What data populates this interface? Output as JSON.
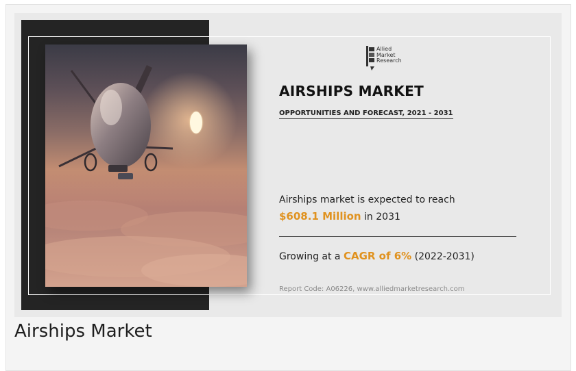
{
  "infographic": {
    "logo": {
      "icon": "allied-market-research-logo-icon",
      "line1": "Allied",
      "line2": "Market",
      "line3": "Research"
    },
    "title": "AIRSHIPS MARKET",
    "subtitle": "OPPORTUNITIES AND FORECAST, 2021 - 2031",
    "reach_text": "Airships market is expected to reach",
    "value": "$608.1 Million",
    "value_suffix": " in 2031",
    "growth_prefix": "Growing at a ",
    "cagr": "CAGR of 6%",
    "growth_period": " (2022-2031)",
    "report_code": "Report Code: A06226, www.alliedmarketresearch.com",
    "image_subject": "airship-above-clouds-at-sunset",
    "accent_color": "#e0921f"
  },
  "caption": "Airships Market"
}
